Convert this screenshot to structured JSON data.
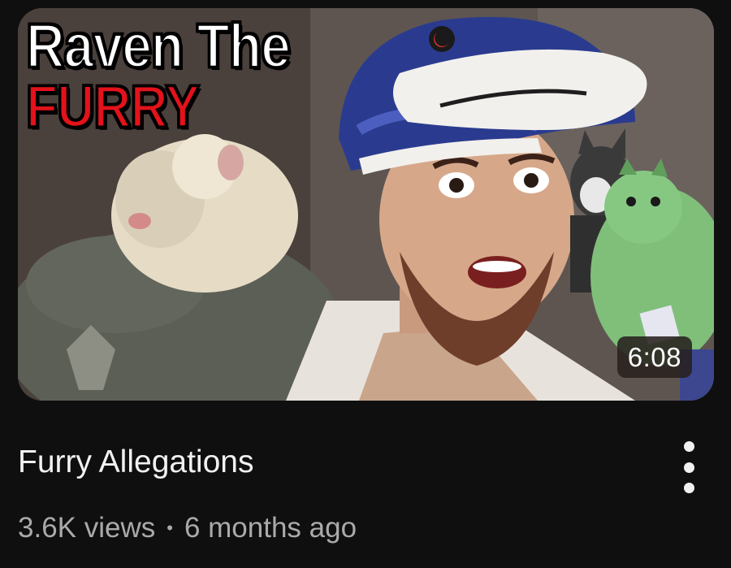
{
  "video": {
    "thumbnail_text_line1": "Raven The",
    "thumbnail_text_line2": "FURRY",
    "duration": "6:08",
    "title": "Furry Allegations",
    "views": "3.6K views",
    "separator": "•",
    "age": "6 months ago"
  },
  "icons": {
    "more": "more-vertical-icon"
  },
  "colors": {
    "background": "#0f0f0f",
    "title_text": "#f1f1f1",
    "meta_text": "#aaaaaa",
    "thumbnail_red_text": "#e3121b"
  }
}
